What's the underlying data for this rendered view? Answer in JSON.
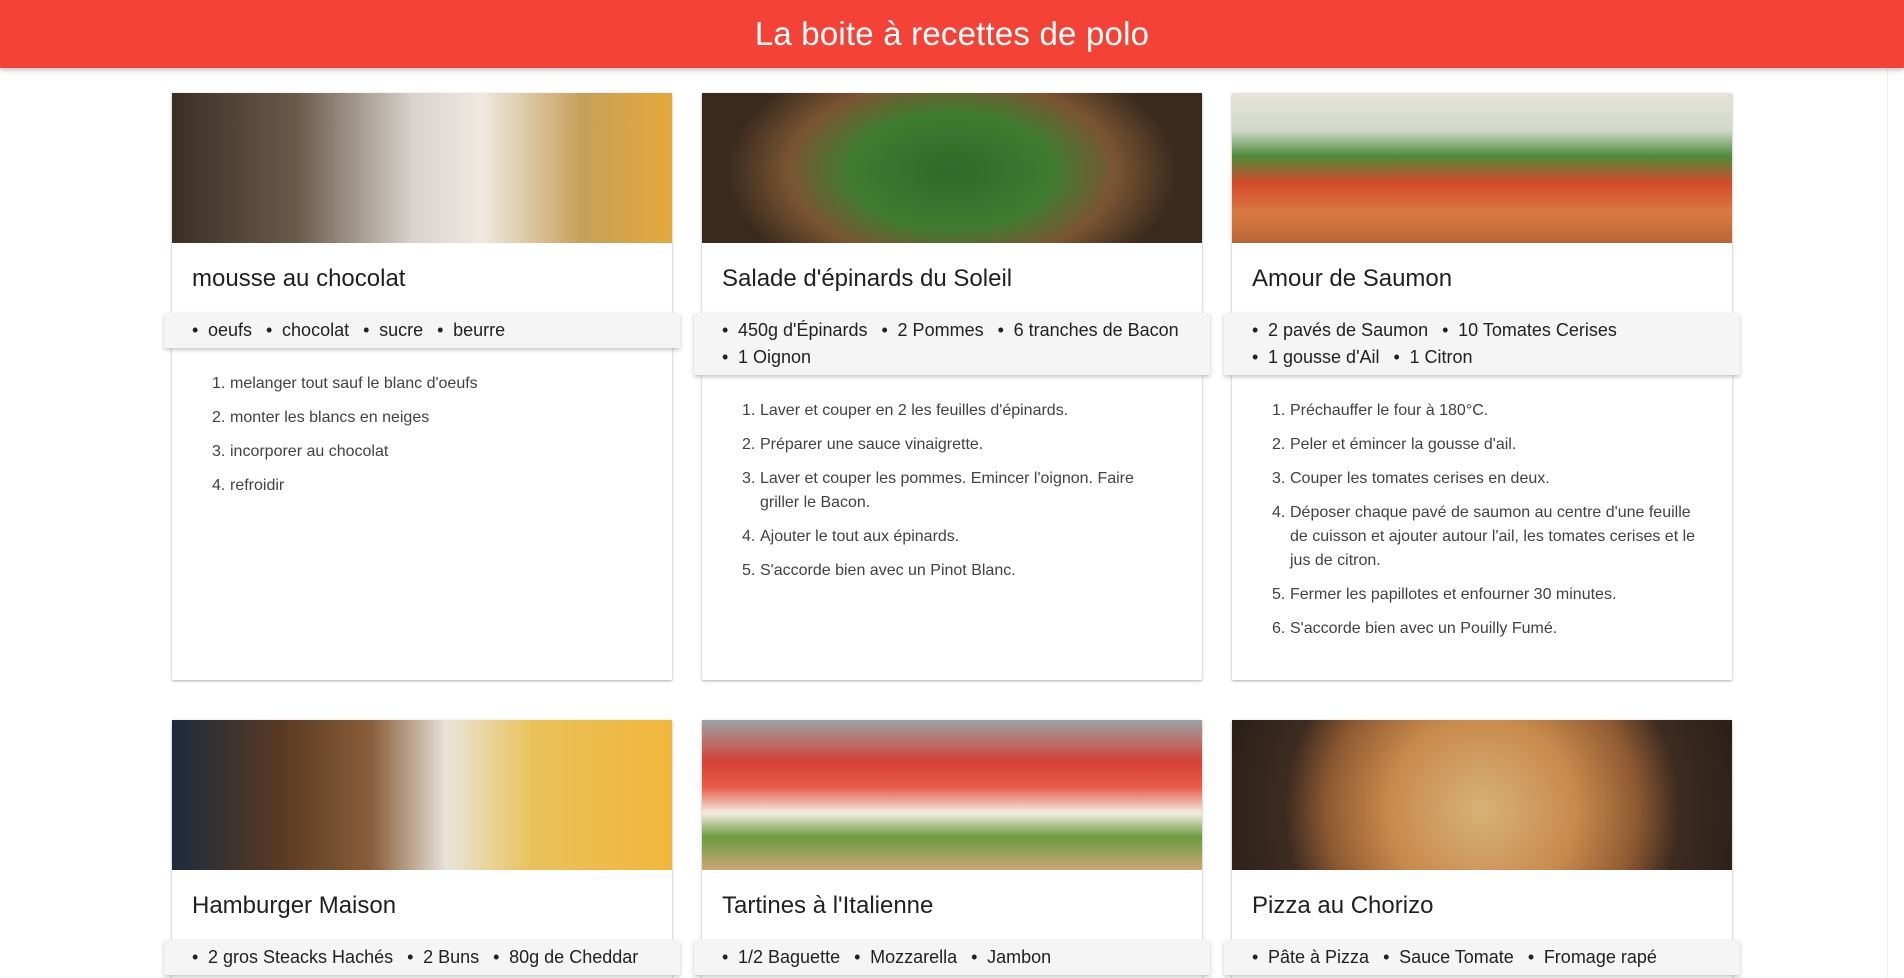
{
  "header": {
    "title": "La boite à recettes de polo"
  },
  "colors": {
    "header_bg": "#f44336",
    "header_text": "#ffffff",
    "ingredients_bg": "#f5f5f5"
  },
  "cards": [
    {
      "image_icon": "chef-cooking-photo",
      "title": "mousse au chocolat",
      "ingredients": [
        "oeufs",
        "chocolat",
        "sucre",
        "beurre"
      ],
      "steps": [
        "melanger tout sauf le blanc d'oeufs",
        "monter les blancs en neiges",
        "incorporer au chocolat",
        "refroidir"
      ]
    },
    {
      "image_icon": "spinach-salad-photo",
      "title": "Salade d'épinards du Soleil",
      "ingredients": [
        "450g d'Épinards",
        "2 Pommes",
        "6 tranches de Bacon",
        "1 Oignon"
      ],
      "steps": [
        "Laver et couper en 2 les feuilles d'épinards.",
        "Préparer une sauce vinaigrette.",
        "Laver et couper les pommes. Emincer l'oignon. Faire griller le Bacon.",
        "Ajouter le tout aux épinards.",
        "S'accorde bien avec un Pinot Blanc."
      ]
    },
    {
      "image_icon": "salmon-plate-photo",
      "title": "Amour de Saumon",
      "ingredients": [
        "2 pavés de Saumon",
        "10 Tomates Cerises",
        "1 gousse d'Ail",
        "1 Citron"
      ],
      "steps": [
        "Préchauffer le four à 180°C.",
        "Peler et émincer la gousse d'ail.",
        "Couper les tomates cerises en deux.",
        "Déposer chaque pavé de saumon au centre d'une feuille de cuisson et ajouter autour l'ail, les tomates cerises et le jus de citron.",
        "Fermer les papillotes et enfourner 30 minutes.",
        "S'accorde bien avec un Pouilly Fumé."
      ]
    },
    {
      "image_icon": "burger-fries-photo",
      "title": "Hamburger Maison",
      "ingredients": [
        "2 gros Steacks Hachés",
        "2 Buns",
        "80g de Cheddar"
      ],
      "steps": []
    },
    {
      "image_icon": "tomato-tartine-photo",
      "title": "Tartines à l'Italienne",
      "ingredients": [
        "1/2 Baguette",
        "Mozzarella",
        "Jambon"
      ],
      "steps": []
    },
    {
      "image_icon": "pizza-photo",
      "title": "Pizza au Chorizo",
      "ingredients": [
        "Pâte à Pizza",
        "Sauce Tomate",
        "Fromage rapé"
      ],
      "steps": []
    }
  ]
}
